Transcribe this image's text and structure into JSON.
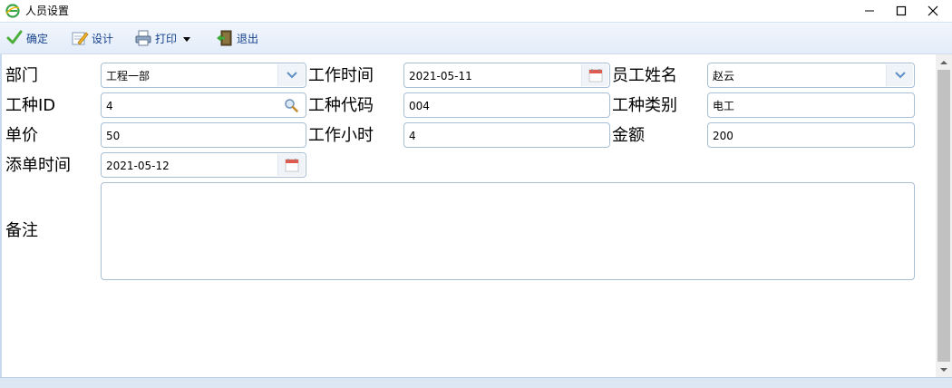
{
  "window": {
    "title": "人员设置"
  },
  "toolbar": {
    "confirm_label": "确定",
    "design_label": "设计",
    "print_label": "打印",
    "exit_label": "退出"
  },
  "form": {
    "department": {
      "label": "部门",
      "value": "工程一部"
    },
    "work_time": {
      "label": "工作时间",
      "value": "2021-05-11"
    },
    "employee_name": {
      "label": "员工姓名",
      "value": "赵云"
    },
    "work_type_id": {
      "label": "工种ID",
      "value": "4"
    },
    "work_type_code": {
      "label": "工种代码",
      "value": "004"
    },
    "work_type_category": {
      "label": "工种类别",
      "value": "电工"
    },
    "unit_price": {
      "label": "单价",
      "value": "50"
    },
    "work_hours": {
      "label": "工作小时",
      "value": "4"
    },
    "amount": {
      "label": "金额",
      "value": "200"
    },
    "add_time": {
      "label": "添单时间",
      "value": "2021-05-12"
    },
    "remark": {
      "label": "备注",
      "value": ""
    }
  },
  "colors": {
    "toolbar_text": "#15428b",
    "field_border": "#a9bfd6",
    "calendar_red": "#e05a4f"
  },
  "icons": [
    "ie-app-icon",
    "check-icon",
    "design-pencil-icon",
    "printer-icon",
    "caret-down-icon",
    "exit-door-icon",
    "chevron-down-icon",
    "calendar-icon",
    "search-icon"
  ]
}
